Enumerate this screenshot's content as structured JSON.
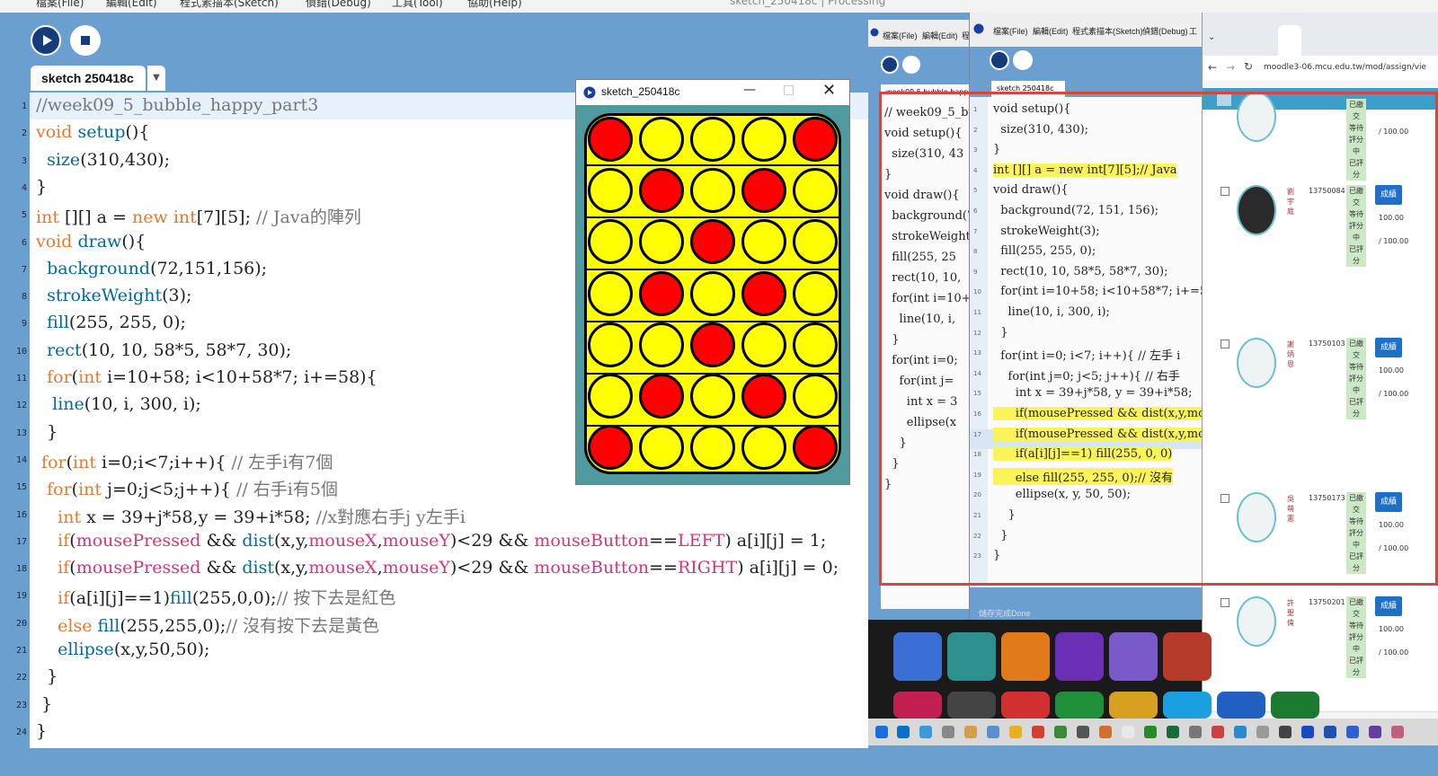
{
  "menubar": [
    "檔案(File)",
    "編輯(Edit)",
    "程式素描本(Sketch)",
    "偵錯(Debug)",
    "工具(Tool)",
    "協助(Help)"
  ],
  "window_title": "sketch_250418c | Processing",
  "tab_label": "sketch 250418c",
  "code_lines": [
    "//week09_5_bubble_happy_part3",
    "void setup(){",
    "  size(310,430);",
    "}",
    "int [][] a = new int[7][5]; // Java的陣列",
    "void draw(){",
    "  background(72,151,156);",
    "  strokeWeight(3);",
    "  fill(255, 255, 0);",
    "  rect(10, 10, 58*5, 58*7, 30);",
    "  for(int i=10+58; i<10+58*7; i+=58){",
    "   line(10, i, 300, i);",
    "  }",
    " for(int i=0;i<7;i++){ // 左手i有7個",
    "  for(int j=0;j<5;j++){ // 右手i有5個",
    "    int x = 39+j*58,y = 39+i*58; //x對應右手j y左手i",
    "    if(mousePressed && dist(x,y,mouseX,mouseY)<29 && mouseButton==LEFT) a[i][j] = 1;",
    "    if(mousePressed && dist(x,y,mouseX,mouseY)<29 && mouseButton==RIGHT) a[i][j] = 0;",
    "    if(a[i][j]==1)fill(255,0,0);// 按下去是紅色",
    "    else fill(255,255,0);// 沒有按下去是黃色",
    "    ellipse(x,y,50,50);",
    "  }",
    " }",
    "}"
  ],
  "sketch_window": {
    "title": "sketch_250418c",
    "board": [
      [
        1,
        0,
        0,
        0,
        1
      ],
      [
        0,
        1,
        0,
        1,
        0
      ],
      [
        0,
        0,
        1,
        0,
        0
      ],
      [
        0,
        1,
        0,
        1,
        0
      ],
      [
        0,
        0,
        1,
        0,
        0
      ],
      [
        0,
        1,
        0,
        1,
        0
      ],
      [
        1,
        0,
        0,
        0,
        1
      ]
    ]
  },
  "ide2": {
    "menu": [
      "檔案(File)",
      "編輯(Edit)",
      "程"
    ],
    "tab": "week09 5 bubble happy",
    "code": [
      "// week09_5_bub",
      "void setup(){",
      "  size(310, 43",
      "}",
      "void draw(){",
      "  background(7",
      "  strokeWeight(",
      "  fill(255, 25",
      "  rect(10, 10,",
      "  for(int i=10+",
      "    line(10, i,",
      "  }",
      "  for(int i=0;",
      "    for(int j=",
      "      int x = 3",
      "      ellipse(x",
      "    }",
      "  }",
      "}"
    ]
  },
  "ide3": {
    "menu": [
      "檔案(File)",
      "編輯(Edit)",
      "程式素描本(Sketch)",
      "偵錯(Debug)",
      "工"
    ],
    "tab": "sketch 250418c",
    "code": [
      "void setup(){",
      "  size(310, 430);",
      "}",
      "int [][] a = new int[7][5];// Java",
      "void draw(){",
      "  background(72, 151, 156);",
      "  strokeWeight(3);",
      "  fill(255, 255, 0);",
      "  rect(10, 10, 58*5, 58*7, 30);",
      "  for(int i=10+58; i<10+58*7; i+=58)",
      "    line(10, i, 300, i);",
      "  }",
      "  for(int i=0; i<7; i++){ // 左手 i",
      "    for(int j=0; j<5; j++){ // 右手",
      "      int x = 39+j*58, y = 39+i*58;",
      "      if(mousePressed && dist(x,y,mo",
      "      if(mousePressed && dist(x,y,mo",
      "      if(a[i][j]==1) fill(255, 0, 0)",
      "      else fill(255, 255, 0);// 沒有",
      "      ellipse(x, y, 50, 50);",
      "    }",
      "  }",
      "}"
    ],
    "line_numbers": [
      "1",
      "2",
      "3",
      "4",
      "5",
      "6",
      "7",
      "8",
      "9",
      "10",
      "11",
      "12",
      "13",
      "14",
      "15",
      "16",
      "17",
      "18",
      "19",
      "20",
      "21",
      "22",
      "23",
      "24"
    ]
  },
  "browser": {
    "address": "moodle3-06.mcu.edu.tw/mod/assign/vie",
    "students": [
      {
        "id": "",
        "name": "",
        "status": [
          "已繳",
          "交",
          "等待",
          "評分",
          "中",
          "已評",
          "分"
        ],
        "btn": "",
        "score1": "/ 100.00",
        "score2": ""
      },
      {
        "id": "13750084",
        "name": "劉 宇庭",
        "status": [
          "已繳",
          "交",
          "等待",
          "評分",
          "中",
          "已評",
          "分"
        ],
        "btn": "成績",
        "score1": "100.00",
        "score2": "/ 100.00"
      },
      {
        "id": "13750103",
        "name": "謝 炳恩",
        "status": [
          "已繳",
          "交",
          "等待",
          "評分",
          "中",
          "已評",
          "分"
        ],
        "btn": "成績",
        "score1": "100.00",
        "score2": "/ 100.00"
      },
      {
        "id": "13750173",
        "name": "吳 萌憲",
        "status": [
          "已繳",
          "交",
          "等待",
          "評分",
          "中",
          "已評",
          "分"
        ],
        "btn": "成績",
        "score1": "100.00",
        "score2": "/ 100.00"
      },
      {
        "id": "13750201",
        "name": "許 聖倫",
        "status": [
          "已繳",
          "交",
          "等待",
          "評分",
          "中",
          "已評",
          "分"
        ],
        "btn": "成績",
        "score1": "100.00",
        "score2": "/ 100.00"
      }
    ]
  },
  "ide3_status": "儲存完成Done"
}
